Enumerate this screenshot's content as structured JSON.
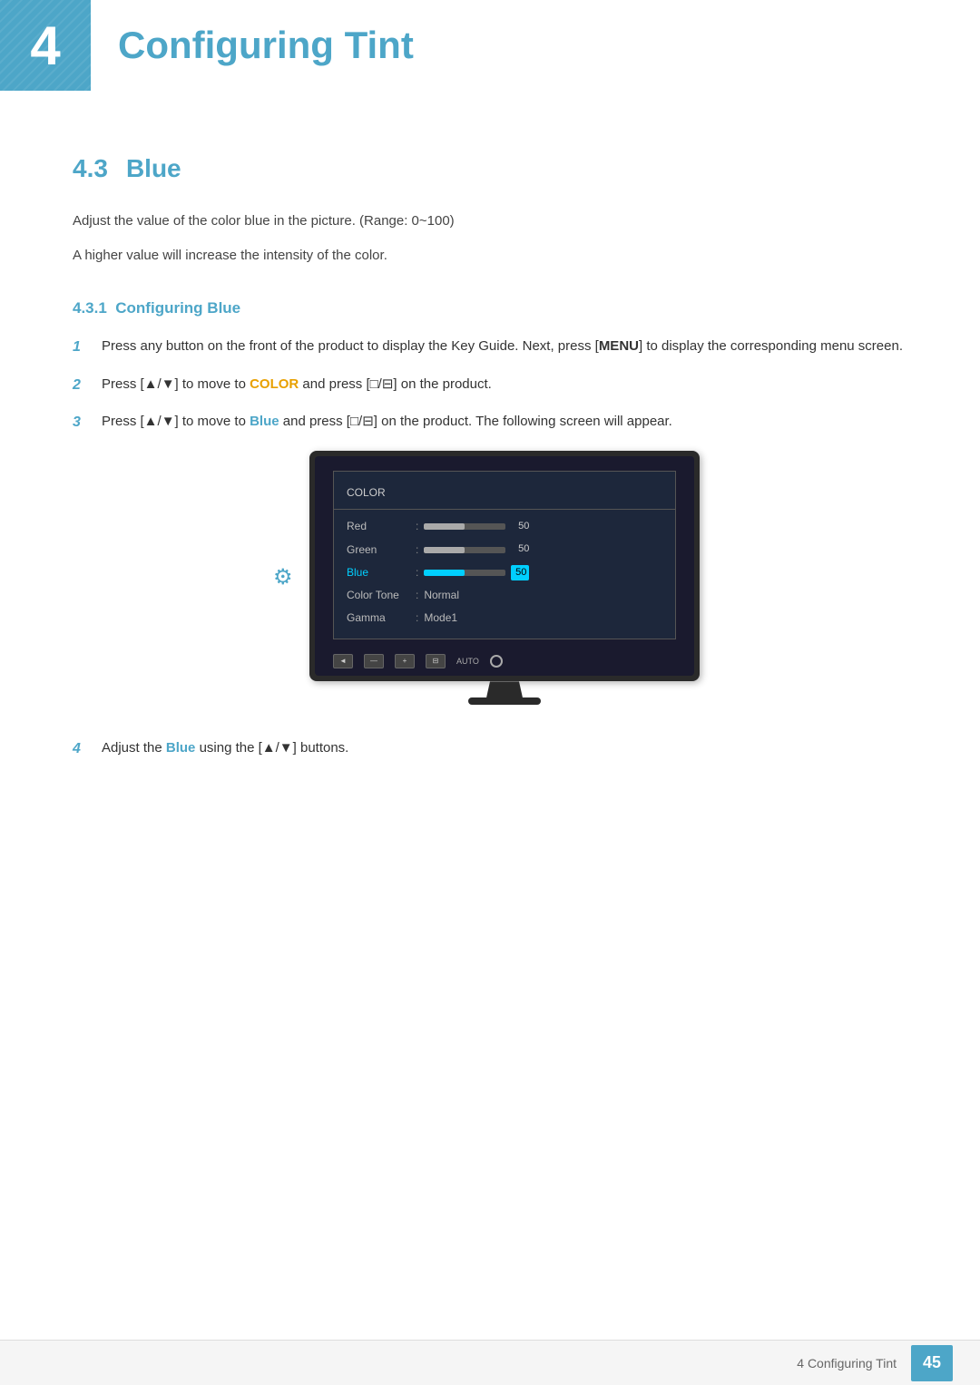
{
  "header": {
    "chapter_number": "4",
    "title": "Configuring Tint"
  },
  "section": {
    "number": "4.3",
    "title": "Blue"
  },
  "descriptions": [
    "Adjust the value of the color blue in the picture. (Range: 0~100)",
    "A higher value will increase the intensity of the color."
  ],
  "subsection": {
    "number": "4.3.1",
    "title": "Configuring Blue"
  },
  "steps": [
    {
      "num": "1",
      "parts": [
        {
          "text": "Press any button on the front of the product to display the Key Guide. Next, press [",
          "type": "normal"
        },
        {
          "text": "MENU",
          "type": "bold"
        },
        {
          "text": "] to display the corresponding menu screen.",
          "type": "normal"
        }
      ]
    },
    {
      "num": "2",
      "parts": [
        {
          "text": "Press [▲/▼] to move to ",
          "type": "normal"
        },
        {
          "text": "COLOR",
          "type": "highlight-color"
        },
        {
          "text": " and press [□/⊟] on the product.",
          "type": "normal"
        }
      ]
    },
    {
      "num": "3",
      "parts": [
        {
          "text": "Press [▲/▼] to move to ",
          "type": "normal"
        },
        {
          "text": "Blue",
          "type": "highlight-blue"
        },
        {
          "text": " and press [□/⊟] on the product. The following screen will appear.",
          "type": "normal"
        }
      ]
    },
    {
      "num": "4",
      "parts": [
        {
          "text": "Adjust the ",
          "type": "normal"
        },
        {
          "text": "Blue",
          "type": "highlight-blue"
        },
        {
          "text": " using the [▲/▼] buttons.",
          "type": "normal"
        }
      ]
    }
  ],
  "color_menu": {
    "title": "COLOR",
    "rows": [
      {
        "label": "Red",
        "type": "bar",
        "value": "50",
        "active": false
      },
      {
        "label": "Green",
        "type": "bar",
        "value": "50",
        "active": false
      },
      {
        "label": "Blue",
        "type": "bar",
        "value": "50",
        "active": true
      },
      {
        "label": "Color Tone",
        "type": "text",
        "value": "Normal",
        "active": false
      },
      {
        "label": "Gamma",
        "type": "text",
        "value": "Mode1",
        "active": false
      }
    ],
    "bottom_buttons": [
      "◄",
      "—",
      "+",
      "⊟",
      "AUTO",
      "⏻"
    ]
  },
  "footer": {
    "text": "4 Configuring Tint",
    "page": "45"
  }
}
